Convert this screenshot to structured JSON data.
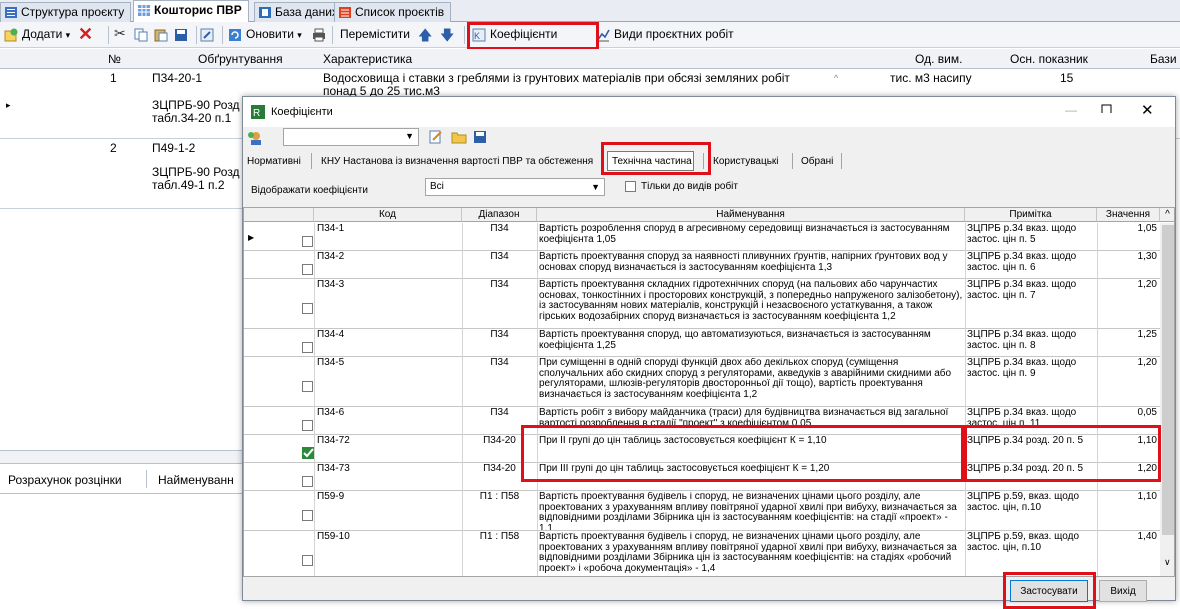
{
  "tabs": [
    {
      "label": "Структура проєкту",
      "color": "#3a6fc4"
    },
    {
      "label": "Кошторис ПВР",
      "color": "#3a6fc4",
      "active": true
    },
    {
      "label": "База даних",
      "color": "#2b6db8"
    },
    {
      "label": "Список проєктів",
      "color": "#e04020"
    }
  ],
  "toolbar": {
    "add": "Додати",
    "refresh": "Оновити",
    "move": "Перемістити",
    "coefficients": "Коефіцієнти",
    "work_types": "Види проєктних робіт"
  },
  "grid": {
    "headers": [
      "№",
      "Обґрунтування",
      "Характеристика",
      "Од. вим.",
      "Осн. показник",
      "Бази"
    ],
    "rows": [
      {
        "num": "1",
        "code": "П34-20-1",
        "basis": "ЗЦПРБ-90 Розд",
        "basis2": "табл.34-20 п.1",
        "desc": "Водосховища і ставки з греблями із грунтових матеріалів при обсязі земляних робіт понад 5 до 25 тис.м3",
        "unit": "тис. м3 насипу",
        "value": "15"
      },
      {
        "num": "2",
        "code": "П49-1-2",
        "basis": "ЗЦПРБ-90 Розд",
        "basis2": "табл.49-1 п.2",
        "desc": "",
        "unit": "",
        "value": ""
      }
    ],
    "bottom_tabs": [
      "Розрахунок розцінки",
      "Найменуванн"
    ]
  },
  "dialog": {
    "title": "Коефіцієнти",
    "combo_value": "",
    "tabs": [
      "Нормативні",
      "КНУ Настанова із визначення вартості ПВР та обстеження",
      "Технічна частина",
      "Користувацькі",
      "Обрані"
    ],
    "filter_label": "Відображати коефіцієнти",
    "filter_value": "Всі",
    "only_works_label": "Тільки до видів робіт",
    "columns": [
      "Код",
      "Діапазон",
      "Найменування",
      "Примітка",
      "Значення"
    ],
    "rows": [
      {
        "code": "П34-1",
        "range": "П34",
        "name": "Вартість розроблення споруд в агресивному середовищі визначається із застосуванням коефіцієнта 1,05",
        "note": "ЗЦПРБ р.34 вказ. щодо застос. цін п. 5",
        "value": "1,05",
        "h": 28
      },
      {
        "code": "П34-2",
        "range": "П34",
        "name": "Вартість проектування споруд за наявності пливунних ґрунтів, напірних ґрунтових вод у основах споруд визначається із застосуванням коефіцієнта 1,3",
        "note": "ЗЦПРБ р.34 вказ. щодо застос. цін п. 6",
        "value": "1,30",
        "h": 28
      },
      {
        "code": "П34-3",
        "range": "П34",
        "name": "Вартість проектування складних гідротехнічних споруд (на пальових або чарунчастих основах, тонкостінних і просторових конструкцій, з попередньо напруженого залізобетону), із застосуванням нових матеріалів, конструкцій і незасвоєного устаткування, а також гірських водозабірних споруд визначається із застосуванням коефіцієнта 1,2",
        "note": "ЗЦПРБ р.34 вказ. щодо застос. цін п. 7",
        "value": "1,20",
        "h": 50
      },
      {
        "code": "П34-4",
        "range": "П34",
        "name": "Вартість проектування споруд, що автоматизуються, визначається із застосуванням коефіцієнта 1,25",
        "note": "ЗЦПРБ р.34 вказ. щодо застос. цін п. 8",
        "value": "1,25",
        "h": 28
      },
      {
        "code": "П34-5",
        "range": "П34",
        "name": "При суміщенні в одній споруді функцій двох або декількох споруд (суміщення сполучальних або скидних споруд з регуляторами, акведуків з аварійними скидними або регуляторами, шлюзів-регуляторів двосторонньої дії тощо), вартість проектування визначається із застосуванням коефіцієнта 1,2",
        "note": "ЗЦПРБ р.34 вказ. щодо застос. цін п. 9",
        "value": "1,20",
        "h": 50
      },
      {
        "code": "П34-6",
        "range": "П34",
        "name": "Вартість робіт з вибору майданчика (траси) для будівництва визначається від загальної вартості розроблення в стадії \"проект\" з коефіцієнтом 0,05",
        "note": "ЗЦПРБ р.34 вказ. щодо застос. цін п. 11",
        "value": "0,05",
        "h": 28
      },
      {
        "code": "П34-72",
        "range": "П34-20",
        "name": "При ІІ групі до цін таблиць застосовується коефіцієнт К = 1,10",
        "note": "ЗЦПРБ р.34 розд. 20 п. 5",
        "value": "1,10",
        "h": 28,
        "checked": true
      },
      {
        "code": "П34-73",
        "range": "П34-20",
        "name": "При ІІІ групі до цін таблиць застосовується коефіцієнт К = 1,20",
        "note": "ЗЦПРБ р.34 розд. 20 п. 5",
        "value": "1,20",
        "h": 28
      },
      {
        "code": "П59-9",
        "range": "П1 : П58",
        "name": "Вартість проектування будівель і споруд, не визначених цінами цього розділу, але проектованих з урахуванням впливу повітряної ударної хвилі при вибуху, визначається за відповідними розділами Збірника цін із застосуванням коефіцієнтів: на стадії «проект» - 1,1",
        "note": "ЗЦПРБ р.59, вказ. щодо застос. цін, п.10",
        "value": "1,10",
        "h": 40
      },
      {
        "code": "П59-10",
        "range": "П1 : П58",
        "name": "Вартість проектування будівель і споруд, не визначених цінами цього розділу, але проектованих з урахуванням впливу повітряної ударної хвилі при вибуху, визначається за відповідними розділами Збірника цін із застосуванням коефіцієнтів: на стадіях «робочий проект» і «робоча документація» - 1,4",
        "note": "ЗЦПРБ р.59, вказ. щодо застос. цін, п.10",
        "value": "1,40",
        "h": 50
      }
    ],
    "apply_label": "Застосувати",
    "exit_label": "Вихід"
  }
}
